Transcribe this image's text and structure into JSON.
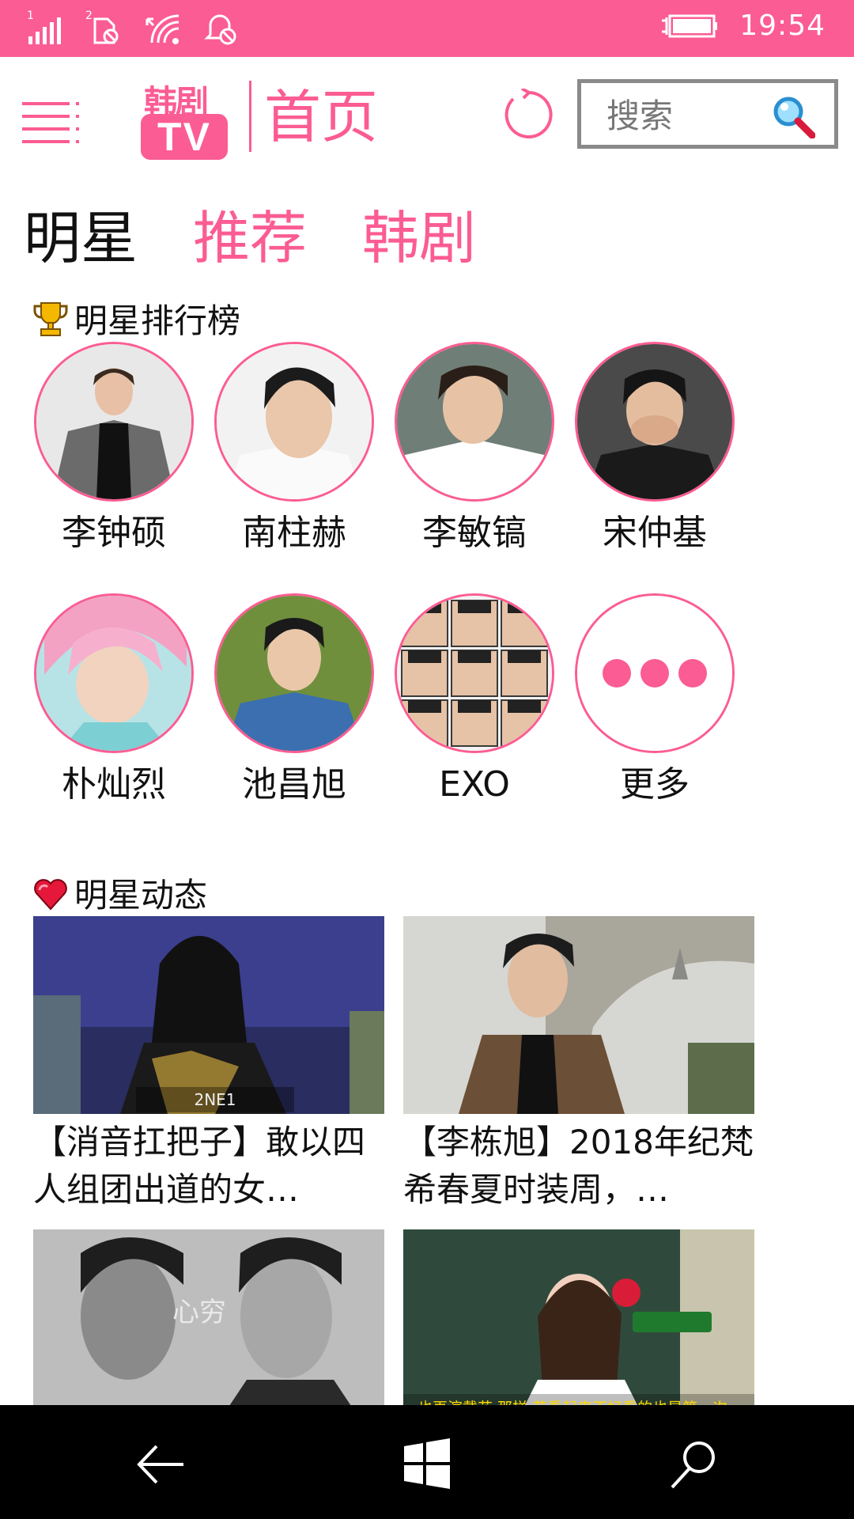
{
  "status_bar": {
    "time": "19:54",
    "sim1_label": "1",
    "sim2_label": "2",
    "icons": [
      "signal-icon",
      "sim2-no-sim-icon",
      "wifi-icon",
      "bell-mute-icon",
      "charging-icon",
      "battery-icon"
    ]
  },
  "header": {
    "logo_top": "韩剧",
    "logo_tv": "TV",
    "page_title": "首页",
    "search_placeholder": "搜索",
    "accent_color": "#fb5c93"
  },
  "tabs": [
    {
      "label": "明星",
      "active": true
    },
    {
      "label": "推荐",
      "active": false
    },
    {
      "label": "韩剧",
      "active": false
    }
  ],
  "ranking": {
    "title": "明星排行榜",
    "items": [
      {
        "name": "李钟硕"
      },
      {
        "name": "南柱赫"
      },
      {
        "name": "李敏镐"
      },
      {
        "name": "宋仲基"
      },
      {
        "name": "朴灿烈"
      },
      {
        "name": "池昌旭"
      },
      {
        "name": "EXO"
      },
      {
        "name": "更多"
      }
    ]
  },
  "feed": {
    "title": "明星动态",
    "cards": [
      {
        "title": "【消音扛把子】敢以四人组团出道的女…",
        "thumb_label": "2NE1"
      },
      {
        "title": "【李栋旭】2018年纪梵希春夏时装周，…",
        "thumb_label": ""
      },
      {
        "title": "",
        "thumb_label": "心穷"
      },
      {
        "title": "",
        "thumb_label": "也再演戴花 那样 花看起来不好看的也是第一次…"
      }
    ]
  },
  "nav": {
    "icons": [
      "back-arrow-icon",
      "windows-start-icon",
      "search-icon"
    ]
  }
}
